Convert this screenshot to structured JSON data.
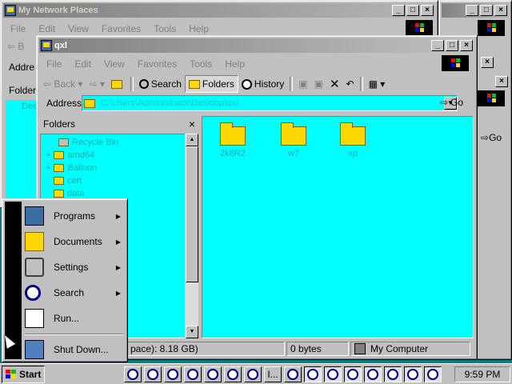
{
  "back_window": {
    "title": "My Network Places",
    "menu": [
      "File",
      "Edit",
      "View",
      "Favorites",
      "Tools",
      "Help"
    ],
    "address_label": "Addre",
    "folders_label": "Folders",
    "tree_peek": "Desk"
  },
  "right_window": {
    "go_label": "Go"
  },
  "main_window": {
    "title": "qxl",
    "menu": [
      "File",
      "Edit",
      "View",
      "Favorites",
      "Tools",
      "Help"
    ],
    "toolbar": {
      "back": "Back",
      "search": "Search",
      "folders": "Folders",
      "history": "History"
    },
    "address_label": "Address",
    "address_value": "C:\\Users\\Administrator\\Desktop\\qxl",
    "go_label": "Go",
    "folders_pane_title": "Folders",
    "tree": [
      "Recycle Bin",
      "amd64",
      "Balloon",
      "cert",
      "data"
    ],
    "files": [
      "2k8R2",
      "w7",
      "xp"
    ],
    "status": {
      "free_space": "pace): 8.18 GB)",
      "size": "0 bytes",
      "zone": "My Computer"
    }
  },
  "start_menu": {
    "items": [
      {
        "label": "Programs",
        "icon": "programs-icon",
        "submenu": true
      },
      {
        "label": "Documents",
        "icon": "documents-icon",
        "submenu": true
      },
      {
        "label": "Settings",
        "icon": "settings-icon",
        "submenu": true
      },
      {
        "label": "Search",
        "icon": "search-icon",
        "submenu": true
      },
      {
        "label": "Run...",
        "icon": "run-icon",
        "submenu": false
      },
      {
        "label": "Shut Down...",
        "icon": "shutdown-icon",
        "submenu": false
      }
    ]
  },
  "taskbar": {
    "start_label": "Start",
    "ellipsis_task": "I...",
    "clock": "9:59 PM"
  }
}
